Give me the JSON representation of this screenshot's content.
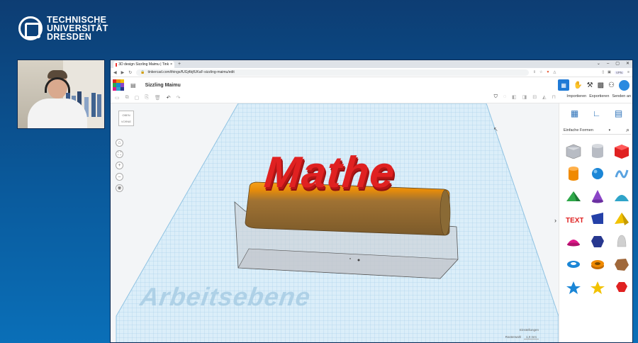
{
  "logo": {
    "line1": "TECHNISCHE",
    "line2": "UNIVERSITÄT",
    "line3": "DRESDEN"
  },
  "browser": {
    "tab_title": "3D design Sizzling Maimu | Tink",
    "tab_close": "×",
    "new_tab": "+",
    "url": "tinkercad.com/things/fUGj4bjfUKaF-sizzling-maimu/edit",
    "vpn_label": "VPN"
  },
  "tinkercad": {
    "design_title": "Sizzling Maimu",
    "import_label": "Importieren",
    "export_label": "Exportieren",
    "send_label": "Senden an"
  },
  "workspace": {
    "viewcube_top": "OBEN",
    "viewcube_front": "VORNE",
    "model_text": "Mathe",
    "workplane_label": "Arbeitsebene",
    "settings_label": "Einstellungen",
    "snap_label": "Rasterwahl",
    "snap_value": "1,0 mm"
  },
  "sidebar": {
    "category": "Einfache Formen",
    "shapes": [
      {
        "name": "box-hole-shape",
        "color": "#b8bcc4"
      },
      {
        "name": "cylinder-hole-shape",
        "color": "#b8bcc4"
      },
      {
        "name": "box-shape",
        "color": "#e02121"
      },
      {
        "name": "cylinder-shape",
        "color": "#f08a00"
      },
      {
        "name": "sphere-shape",
        "color": "#1b86d6"
      },
      {
        "name": "scribble-shape",
        "color": "#5aa3e0"
      },
      {
        "name": "roof-shape",
        "color": "#2fa84a"
      },
      {
        "name": "cone-shape",
        "color": "#8b45c7"
      },
      {
        "name": "round-roof-shape",
        "color": "#2fa4c9"
      },
      {
        "name": "text-shape",
        "color": "#e02121"
      },
      {
        "name": "wedge-shape",
        "color": "#2440a8"
      },
      {
        "name": "pyramid-shape",
        "color": "#f2c200"
      },
      {
        "name": "half-sphere-shape",
        "color": "#e0188a"
      },
      {
        "name": "polygon-shape",
        "color": "#27378f"
      },
      {
        "name": "paraboloid-shape",
        "color": "#d0d0d0"
      },
      {
        "name": "torus-shape",
        "color": "#1b86d6"
      },
      {
        "name": "tube-shape",
        "color": "#f08a00"
      },
      {
        "name": "icosahedron-shape",
        "color": "#a0683a"
      },
      {
        "name": "star-shape",
        "color": "#1b86d6"
      },
      {
        "name": "star-yellow-shape",
        "color": "#f2c200"
      },
      {
        "name": "heart-shape",
        "color": "#e02121"
      }
    ]
  },
  "colors": {
    "accent": "#1f7ad6",
    "mathe_red": "#e02121",
    "cylinder_orange": "#f08a00"
  }
}
